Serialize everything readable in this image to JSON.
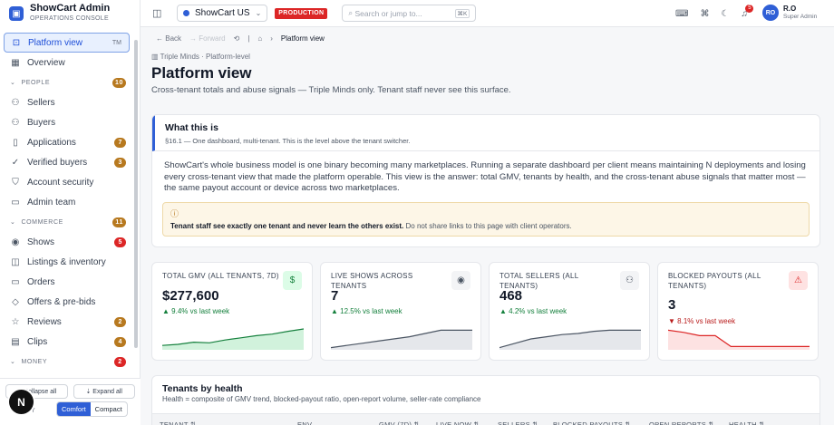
{
  "brand": {
    "name": "ShowCart Admin",
    "sub": "OPERATIONS CONSOLE"
  },
  "sidebar": {
    "active": {
      "label": "Platform view",
      "tag": "TM"
    },
    "items": [
      {
        "type": "item",
        "label": "Overview",
        "icon": "grid-icon",
        "glyph": "▦"
      },
      {
        "type": "section",
        "label": "PEOPLE",
        "badge": "10",
        "badge_color": "amber"
      },
      {
        "type": "item",
        "label": "Sellers",
        "icon": "users-icon",
        "glyph": "⚇"
      },
      {
        "type": "item",
        "label": "Buyers",
        "icon": "user-icon",
        "glyph": "⚇"
      },
      {
        "type": "item",
        "label": "Applications",
        "icon": "file-icon",
        "glyph": "▯",
        "badge": "7",
        "badge_color": "amber"
      },
      {
        "type": "item",
        "label": "Verified buyers",
        "icon": "check-circle-icon",
        "glyph": "✓",
        "badge": "3",
        "badge_color": "amber"
      },
      {
        "type": "item",
        "label": "Account security",
        "icon": "shield-icon",
        "glyph": "⛉"
      },
      {
        "type": "item",
        "label": "Admin team",
        "icon": "team-icon",
        "glyph": "▭"
      },
      {
        "type": "section",
        "label": "COMMERCE",
        "badge": "11",
        "badge_color": "amber"
      },
      {
        "type": "item",
        "label": "Shows",
        "icon": "broadcast-icon",
        "glyph": "◉",
        "badge": "5",
        "badge_color": "red"
      },
      {
        "type": "item",
        "label": "Listings & inventory",
        "icon": "box-icon",
        "glyph": "◫"
      },
      {
        "type": "item",
        "label": "Orders",
        "icon": "cart-icon",
        "glyph": "▭"
      },
      {
        "type": "item",
        "label": "Offers & pre-bids",
        "icon": "tag-icon",
        "glyph": "◇"
      },
      {
        "type": "item",
        "label": "Reviews",
        "icon": "star-icon",
        "glyph": "☆",
        "badge": "2",
        "badge_color": "amber"
      },
      {
        "type": "item",
        "label": "Clips",
        "icon": "film-icon",
        "glyph": "▤",
        "badge": "4",
        "badge_color": "amber"
      },
      {
        "type": "section",
        "label": "MONEY",
        "badge": "2",
        "badge_color": "red"
      }
    ],
    "footer": {
      "collapse": "Collapse all",
      "expand": "Expand all",
      "density_label": "Y",
      "comfort": "Comfort",
      "compact": "Compact",
      "fab": "N"
    }
  },
  "topbar": {
    "store": "ShowCart US",
    "env": "PRODUCTION",
    "search_placeholder": "Search or jump to...",
    "search_kbd": "⌘K",
    "notifications": "5",
    "user": {
      "initials": "RO",
      "name": "R.O",
      "role": "Super Admin"
    }
  },
  "breadcrumb": {
    "back": "Back",
    "forward": "Forward",
    "current": "Platform view"
  },
  "page": {
    "eyebrow": "Triple Minds · Platform-level",
    "title": "Platform view",
    "subtitle": "Cross-tenant totals and abuse signals — Triple Minds only. Tenant staff never see this surface."
  },
  "what": {
    "title": "What this is",
    "sub": "§16.1 — One dashboard, multi-tenant. This is the level above the tenant switcher.",
    "body": "ShowCart's whole business model is one binary becoming many marketplaces. Running a separate dashboard per client means maintaining N deployments and losing every cross-tenant view that made the platform operable. This view is the answer: total GMV, tenants by health, and the cross-tenant abuse signals that matter most — the same payout account or device across two marketplaces.",
    "warn_bold": "Tenant staff see exactly one tenant and never learn the others exist.",
    "warn_rest": " Do not share links to this page with client operators."
  },
  "kpis": [
    {
      "label": "TOTAL GMV (ALL TENANTS, 7D)",
      "value": "$277,600",
      "delta": "▲ 9.4% vs last week",
      "trend": "up",
      "icon": "dollar-icon",
      "glyph": "$",
      "color": "#15803d",
      "icon_bg": "#dcfce7",
      "fill": "#d1f2dc",
      "series": [
        2,
        2.5,
        3.5,
        3.2,
        4.5,
        5.5,
        6.5,
        7.2,
        8.5,
        9.6
      ]
    },
    {
      "label": "LIVE SHOWS ACROSS TENANTS",
      "value": "7",
      "delta": "▲ 12.5% vs last week",
      "trend": "up",
      "icon": "broadcast-icon",
      "glyph": "◉",
      "color": "#4b5563",
      "icon_bg": "#f3f4f6",
      "fill": "#e5e7eb",
      "series": [
        1,
        2,
        3,
        4,
        5,
        6,
        7.5,
        9,
        9,
        9
      ]
    },
    {
      "label": "TOTAL SELLERS (ALL TENANTS)",
      "value": "468",
      "delta": "▲ 4.2% vs last week",
      "trend": "up",
      "icon": "users-icon",
      "glyph": "⚇",
      "color": "#4b5563",
      "icon_bg": "#f3f4f6",
      "fill": "#e5e7eb",
      "series": [
        1,
        3,
        5,
        6,
        7,
        7.5,
        8.5,
        9,
        9,
        9
      ]
    },
    {
      "label": "BLOCKED PAYOUTS (ALL TENANTS)",
      "value": "3",
      "delta": "▼ 8.1% vs last week",
      "trend": "down",
      "icon": "alert-icon",
      "glyph": "⚠",
      "color": "#dc2626",
      "icon_bg": "#fee2e2",
      "fill": "#fde2e2",
      "series": [
        9,
        8,
        6.5,
        6.5,
        1.5,
        1.5,
        1.5,
        1.5,
        1.5,
        1.5
      ]
    }
  ],
  "tenants": {
    "title": "Tenants by health",
    "sub": "Health = composite of GMV trend, blocked-payout ratio, open-report volume, seller-rate compliance",
    "columns": [
      "TENANT ⇅",
      "ENV",
      "GMV (7D) ⇅",
      "LIVE NOW ⇅",
      "SELLERS ⇅",
      "BLOCKED PAYOUTS ⇅",
      "OPEN REPORTS ⇅",
      "HEALTH ⇅"
    ]
  }
}
